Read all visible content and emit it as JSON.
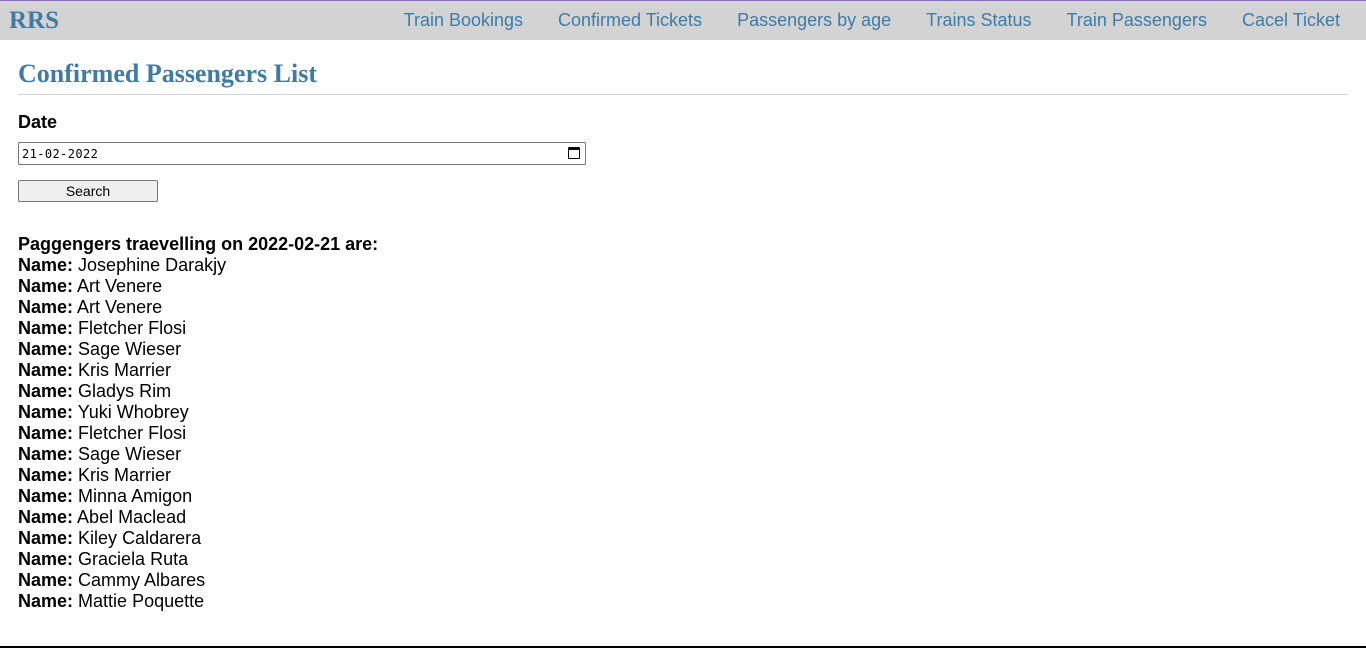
{
  "navbar": {
    "brand": "RRS",
    "links": [
      "Train Bookings",
      "Confirmed Tickets",
      "Passengers by age",
      "Trains Status",
      "Train Passengers",
      "Cacel Ticket"
    ]
  },
  "main": {
    "title": "Confirmed Passengers List",
    "date_label": "Date",
    "date_value": "21-02-2022",
    "search_label": "Search",
    "results_heading": "Paggengers traevelling on 2022-02-21 are:",
    "name_prefix": "Name:",
    "passengers": [
      "Josephine Darakjy",
      "Art Venere",
      "Art Venere",
      "Fletcher Flosi",
      "Sage Wieser",
      "Kris Marrier",
      "Gladys Rim",
      "Yuki Whobrey",
      "Fletcher Flosi",
      "Sage Wieser",
      "Kris Marrier",
      "Minna Amigon",
      "Abel Maclead",
      "Kiley Caldarera",
      "Graciela Ruta",
      "Cammy Albares",
      "Mattie Poquette"
    ]
  },
  "colors": {
    "accent": "#3e7ca6",
    "navbar_bg": "#d3d3d3"
  }
}
